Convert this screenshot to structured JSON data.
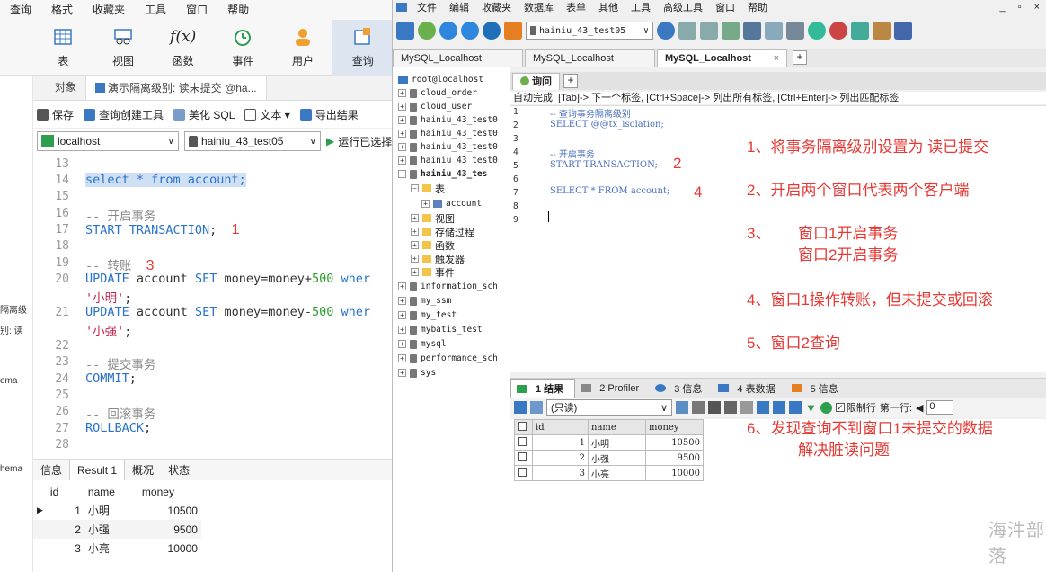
{
  "left": {
    "menu": [
      "查询",
      "格式",
      "收藏夹",
      "工具",
      "窗口",
      "帮助"
    ],
    "ribbon": [
      {
        "label": "表",
        "icon": "table-icon"
      },
      {
        "label": "视图",
        "icon": "view-icon"
      },
      {
        "label": "函数",
        "icon": "function-icon"
      },
      {
        "label": "事件",
        "icon": "event-clock-icon"
      },
      {
        "label": "用户",
        "icon": "user-icon"
      },
      {
        "label": "查询",
        "icon": "query-icon"
      }
    ],
    "tabs": {
      "objects": "对象",
      "query": "演示隔离级别: 读未提交 @ha..."
    },
    "toolbar": {
      "save": "保存",
      "builder": "查询创建工具",
      "beautify": "美化 SQL",
      "text": "文本 ▾",
      "export": "导出结果"
    },
    "connection": "localhost",
    "database": "hainiu_43_test05",
    "run": "运行已选择",
    "side": {
      "a": "隔离级",
      "b": "别: 读",
      "c": "ema",
      "d": "hema"
    },
    "lines": {
      "l13": "13",
      "l14": "14",
      "l15": "15",
      "l16": "16",
      "l17": "17",
      "l18": "18",
      "l19": "19",
      "l20": "20",
      "l21": "21",
      "l22": "22",
      "l23": "23",
      "l24": "24",
      "l25": "25",
      "l26": "26",
      "l27": "27",
      "l28": "28"
    },
    "code": {
      "c14": "select * from account;",
      "c16": "-- 开启事务",
      "c17a": "START TRANSACTION",
      "c17b": ";",
      "c19": "-- 转账",
      "c20a": "UPDATE",
      "c20b": " account ",
      "c20c": "SET",
      "c20d": " money=money+",
      "c20e": "500",
      "c20f": " wher",
      "c20g": "'小明'",
      "c20h": ";",
      "c21a": "UPDATE",
      "c21b": " account ",
      "c21c": "SET",
      "c21d": " money=money-",
      "c21e": "500",
      "c21f": " wher",
      "c21g": "'小强'",
      "c21h": ";",
      "c23": "-- 提交事务",
      "c24a": "COMMIT",
      "c24b": ";",
      "c26": "-- 回滚事务",
      "c27a": "ROLLBACK",
      "c27b": ";"
    },
    "marks": {
      "m1": "1",
      "m3": "3"
    },
    "result_tabs": [
      "信息",
      "Result 1",
      "概况",
      "状态"
    ],
    "result": {
      "headers": [
        "id",
        "name",
        "money"
      ],
      "rows": [
        [
          "1",
          "小明",
          "10500"
        ],
        [
          "2",
          "小强",
          "9500"
        ],
        [
          "3",
          "小亮",
          "10000"
        ]
      ]
    }
  },
  "right": {
    "menu": [
      "文件",
      "编辑",
      "收藏夹",
      "数据库",
      "表单",
      "其他",
      "工具",
      "高级工具",
      "窗口",
      "帮助"
    ],
    "database": "hainiu_43_test05",
    "conn_tabs": [
      "MySQL_Localhost",
      "MySQL_Localhost",
      "MySQL_Localhost"
    ],
    "tree": {
      "root": "root@localhost",
      "items": [
        "cloud_order",
        "cloud_user",
        "hainiu_43_test0",
        "hainiu_43_test0",
        "hainiu_43_test0",
        "hainiu_43_test0",
        "hainiu_43_tes"
      ],
      "tables": "表",
      "account": "account",
      "folders": [
        "视图",
        "存储过程",
        "函数",
        "触发器",
        "事件"
      ],
      "rest": [
        "information_sch",
        "my_ssm",
        "my_test",
        "mybatis_test",
        "mysql",
        "performance_sch",
        "sys"
      ]
    },
    "query_tab": "询问",
    "hint": "自动完成: [Tab]-> 下一个标签, [Ctrl+Space]-> 列出所有标签, [Ctrl+Enter]-> 列出匹配标签",
    "qlines": [
      "1",
      "2",
      "3",
      "4",
      "5",
      "6",
      "7",
      "8",
      "9"
    ],
    "qcode": {
      "q1": "-- 查询事务隔离级别",
      "q2": "SELECT @@tx_isolation;",
      "q4": "-- 开启事务",
      "q5": "START TRANSACTION;",
      "q7": "SELECT * FROM account;"
    },
    "marks": {
      "m2": "2",
      "m4": "4"
    },
    "notes": {
      "n1": "1、将事务隔离级别设置为 读已提交",
      "n2": "2、开启两个窗口代表两个客户端",
      "n3a": "3、",
      "n3b": "窗口1开启事务",
      "n3c": "窗口2开启事务",
      "n4": "4、窗口1操作转账，但未提交或回滚",
      "n5": "5、窗口2查询",
      "n6a": "6、发现查询不到窗口1未提交的数据",
      "n6b": "解决脏读问题"
    },
    "result_tabs": [
      "1 结果",
      "2 Profiler",
      "3 信息",
      "4 表数据",
      "5 信息"
    ],
    "readonly": "(只读)",
    "limit": "限制行",
    "first_row": "第一行:",
    "first_row_value": "0",
    "result": {
      "headers": [
        "id",
        "name",
        "money"
      ],
      "rows": [
        [
          "1",
          "小明",
          "10500"
        ],
        [
          "2",
          "小强",
          "9500"
        ],
        [
          "3",
          "小亮",
          "10000"
        ]
      ]
    },
    "watermark": "海汼部落"
  }
}
